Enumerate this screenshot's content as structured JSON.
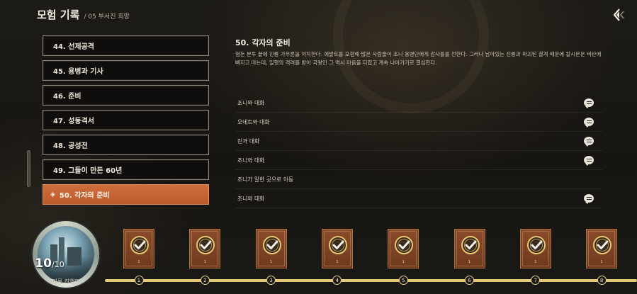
{
  "header": {
    "title": "모험 기록",
    "subtitle": "/ 05 부서진 희망"
  },
  "back_button": {
    "icon": "back-arrow-icon"
  },
  "chapters": [
    {
      "label": "44. 선제공격",
      "active": false
    },
    {
      "label": "45. 용병과 기사",
      "active": false
    },
    {
      "label": "46. 준비",
      "active": false
    },
    {
      "label": "47. 성동격서",
      "active": false
    },
    {
      "label": "48. 공성전",
      "active": false
    },
    {
      "label": "49. 그들이 만든 60년",
      "active": false
    },
    {
      "label": "50. 각자의 준비",
      "active": true,
      "marker": "◈"
    }
  ],
  "detail": {
    "title": "50. 각자의 준비",
    "description": "험든 분투 끝에 진룡 가우론을 처치한다. 에발트를 포함해 많은 사람들이 조니 용병단에게 감사를를 전한다. 그러나 남아있는 진룡과 파괴된 결계 때문에 칼시온은 비탄에 빠지고 마는데, 일행의 격려를 받아 국왕인 그 역시 마음을 다잡고 계속 나아가기로 결심한다.",
    "quests": [
      {
        "label": "조니와 대화",
        "icon": "chat-bubble-icon"
      },
      {
        "label": "오네트와 대화",
        "icon": "chat-bubble-icon"
      },
      {
        "label": "린과 대화",
        "icon": "chat-bubble-icon"
      },
      {
        "label": "조니와 대화",
        "icon": "chat-bubble-icon"
      },
      {
        "label": "조니가 말한 곳으로 이동",
        "icon": ""
      },
      {
        "label": "조니와 대화",
        "icon": "chat-bubble-icon"
      }
    ]
  },
  "progress": {
    "current": "10",
    "total": "/10",
    "label": "기록 진행도"
  },
  "timeline": {
    "nodes": [
      "1",
      "2",
      "3",
      "4",
      "5",
      "6",
      "7",
      "8"
    ],
    "card_number": "1",
    "card_icon": "check-badge-icon"
  },
  "colors": {
    "accent": "#c8602f",
    "timeline": "#e2c877",
    "card": "#7a4125"
  }
}
